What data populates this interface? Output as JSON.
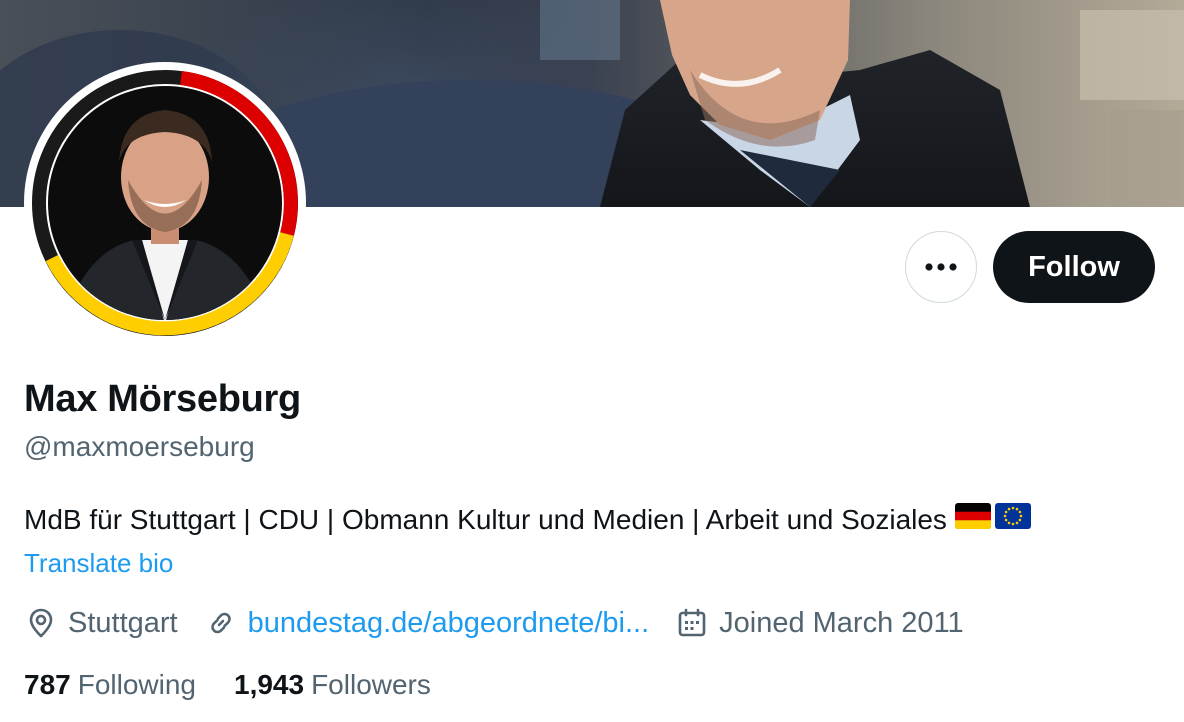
{
  "profile": {
    "display_name": "Max Mörseburg",
    "handle": "@maxmoerseburg",
    "bio_text": "MdB für Stuttgart | CDU | Obmann Kultur und Medien | Arbeit und Soziales",
    "bio_flags": [
      "german-flag",
      "eu-flag"
    ],
    "translate_label": "Translate bio",
    "location": "Stuttgart",
    "website": "bundestag.de/abgeordnete/bi...",
    "joined": "Joined March 2011"
  },
  "actions": {
    "more_icon": "more-horizontal-icon",
    "follow_label": "Follow"
  },
  "stats": {
    "following_count": "787",
    "following_label": "Following",
    "followers_count": "1,943",
    "followers_label": "Followers"
  },
  "avatar": {
    "ring_colors": [
      "#000000",
      "#dd0000",
      "#ffce00"
    ]
  },
  "colors": {
    "text_primary": "#0f1419",
    "text_secondary": "#536471",
    "link": "#1d9bf0",
    "follow_button_bg": "#0f1419",
    "follow_button_text": "#ffffff",
    "border": "#cfd9de"
  }
}
